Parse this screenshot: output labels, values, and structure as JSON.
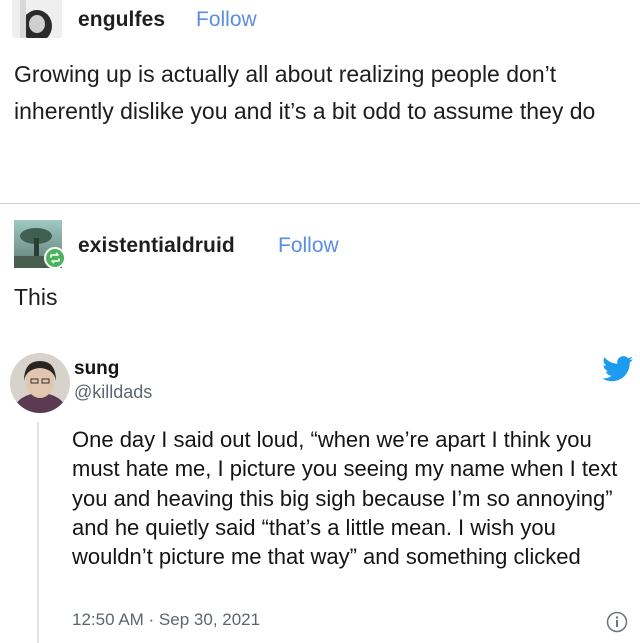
{
  "post1": {
    "username": "engulfes",
    "follow_label": "Follow",
    "text": "Growing up is actually all about realizing people don’t inherently dislike you and it’s a bit odd to assume they do"
  },
  "post2": {
    "username": "existentialdruid",
    "follow_label": "Follow",
    "text": "This"
  },
  "tweet": {
    "name": "sung",
    "handle": "@killdads",
    "text": "One day I said out loud, “when we’re apart I think you must hate me, I picture you seeing my name when I text you and heaving this big sigh because I’m so annoying” and he quietly said “that’s a little mean. I wish you wouldn’t picture me that way” and something clicked",
    "timestamp": "12:50 AM · Sep 30, 2021"
  },
  "icons": {
    "twitter": "twitter-bird-icon",
    "info": "info-icon",
    "reblog": "reblog-icon"
  },
  "colors": {
    "follow": "#5a8ee4",
    "twitter": "#1d9bf0",
    "reblog_badge": "#4cb35c",
    "muted": "#5b6670"
  }
}
